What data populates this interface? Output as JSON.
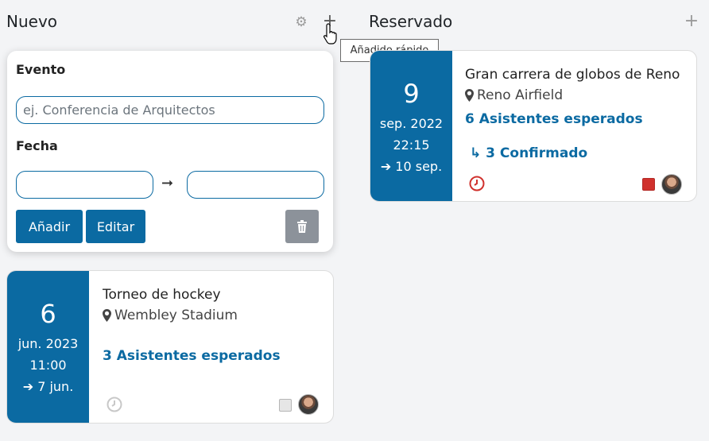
{
  "columns": {
    "new": {
      "title": "Nuevo"
    },
    "reserved": {
      "title": "Reservado"
    }
  },
  "tooltip": "Añadido rápido",
  "form": {
    "event_label": "Evento",
    "event_placeholder": "ej. Conferencia de Arquitectos",
    "date_label": "Fecha",
    "date_separator": "➞",
    "start_value": "",
    "end_value": "",
    "add_button": "Añadir",
    "edit_button": "Editar",
    "delete_icon": "trash-icon"
  },
  "cards": [
    {
      "day": "9",
      "month_year": "sep. 2022",
      "time": "22:15",
      "end": "➔ 10 sep.",
      "title": "Gran carrera de globos de Reno",
      "location": "Reno Airfield",
      "attendees": "6 Asistentes esperados",
      "confirmed": "↳ 3 Confirmado",
      "clock_color": "#d0312d",
      "swatch_color": "#d0312d"
    },
    {
      "day": "6",
      "month_year": "jun. 2023",
      "time": "11:00",
      "end": "➔ 7 jun.",
      "title": "Torneo de hockey",
      "location": "Wembley Stadium",
      "attendees": "3 Asistentes esperados",
      "clock_color": "#c8c8c8",
      "swatch_color": "#e2e2e2"
    }
  ],
  "colors": {
    "accent": "#0b6aa2",
    "delete": "#8c929a"
  }
}
